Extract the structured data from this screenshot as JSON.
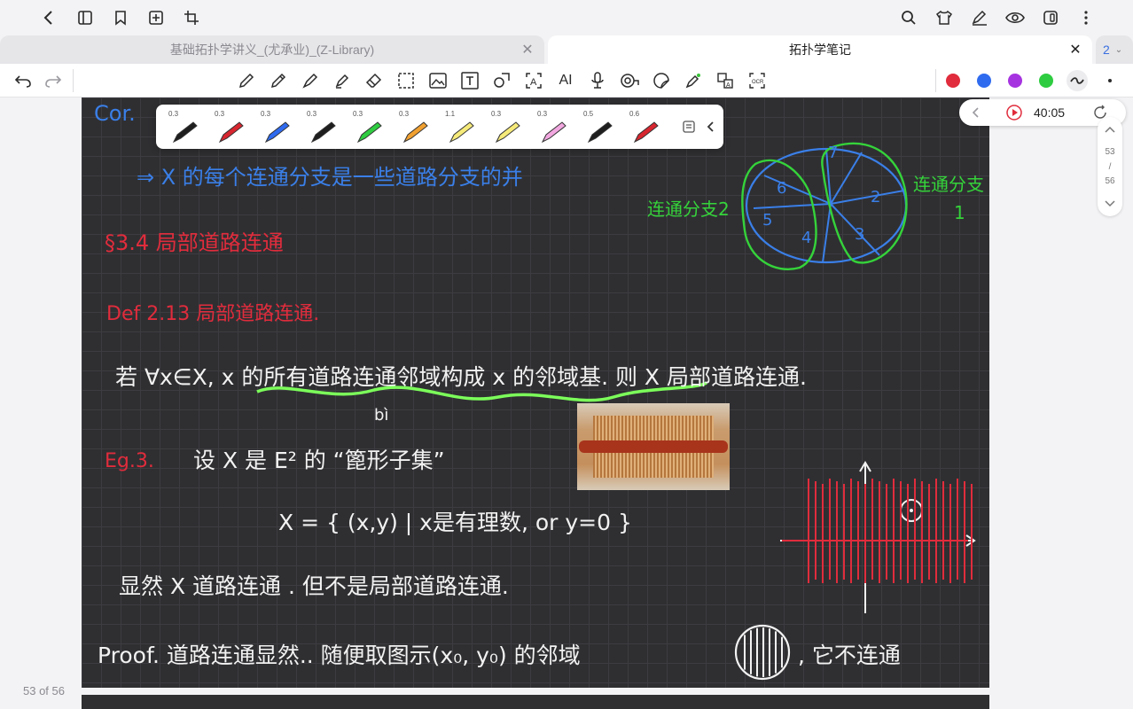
{
  "tabs": [
    {
      "label": "基础拓扑学讲义_(尤承业)_(Z-Library)",
      "active": false
    },
    {
      "label": "拓扑学笔记",
      "active": true
    }
  ],
  "tab_count": "2",
  "timer": "40:05",
  "page_indicator": {
    "current": "53",
    "sep": "/",
    "total": "56"
  },
  "page_label": "53 of 56",
  "pen_sizes": [
    "0.3",
    "0.3",
    "0.3",
    "0.3",
    "0.3",
    "0.3",
    "1.1",
    "0.3",
    "0.3",
    "0.5",
    "0.6"
  ],
  "colors": {
    "red": "#e02c3c",
    "blue": "#2f6bef",
    "purple": "#a633e0",
    "green": "#2ecc40"
  },
  "note": {
    "cor": "Cor.",
    "cor_line": "⇒ X 的每个连通分支是一些道路分支的并",
    "diagram_left": "连通分支2",
    "diagram_right": "连通分支",
    "diagram_right_num": "1",
    "section": "§3.4  局部道路连通",
    "def": "Def  2.13   局部道路连通.",
    "def_body": "若 ∀x∈X,  x 的所有道路连通邻域构成 x 的邻域基.  则 X 局部道路连通.",
    "eg": "Eg.3.",
    "eg_body": "设 X 是 E² 的 “篦形子集”",
    "bi": "bì",
    "set": "X = { (x,y) | x是有理数,  or  y=0 }",
    "clear": "显然 X 道路连通  . 但不是局部道路连通.",
    "proof": "Proof.  道路连通显然..   随便取图示(x₀, y₀) 的邻域",
    "proof_end": ", 它不连通"
  }
}
